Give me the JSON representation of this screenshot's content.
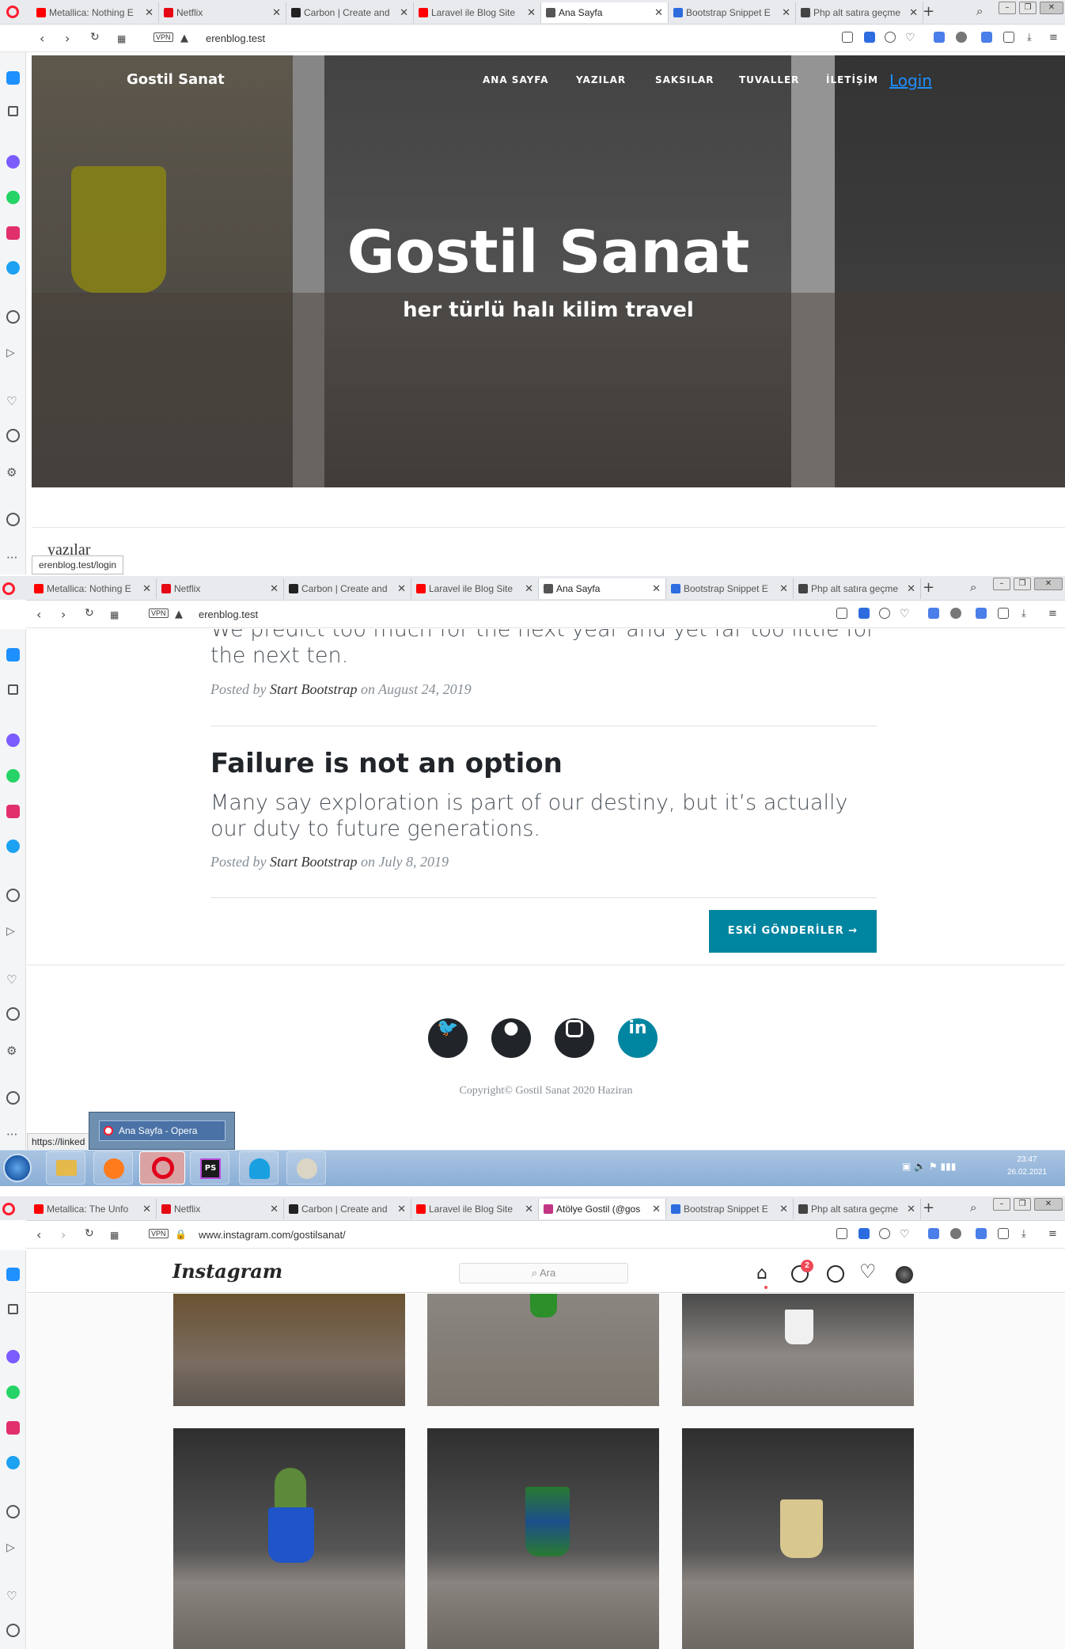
{
  "window1": {
    "tabs": [
      {
        "title": "Metallica: Nothing E",
        "color": "#ff0000"
      },
      {
        "title": "Netflix",
        "color": "#e50914"
      },
      {
        "title": "Carbon | Create and",
        "color": "#222222"
      },
      {
        "title": "Laravel ile Blog Site",
        "color": "#ff0000"
      },
      {
        "title": "Ana Sayfa",
        "color": "#555555",
        "active": true
      },
      {
        "title": "Bootstrap Snippet E",
        "color": "#2d6cdf"
      },
      {
        "title": "Php alt satıra geçme",
        "color": "#444444"
      }
    ],
    "url": "erenblog.test",
    "site": {
      "brand": "Gostil Sanat",
      "nav": [
        "ANA SAYFA",
        "YAZILAR",
        "SAKSILAR",
        "TUVALLER",
        "İLETİŞİM"
      ],
      "login": "Login",
      "hero_title": "Gostil Sanat",
      "hero_subtitle": "her türlü halı kilim travel",
      "section_label": "yazılar"
    },
    "status_tooltip": "erenblog.test/login"
  },
  "window2": {
    "tabs": [
      {
        "title": "Metallica: Nothing E",
        "color": "#ff0000"
      },
      {
        "title": "Netflix",
        "color": "#e50914"
      },
      {
        "title": "Carbon | Create and",
        "color": "#222222"
      },
      {
        "title": "Laravel ile Blog Site",
        "color": "#ff0000"
      },
      {
        "title": "Ana Sayfa",
        "color": "#555555",
        "active": true
      },
      {
        "title": "Bootstrap Snippet E",
        "color": "#2d6cdf"
      },
      {
        "title": "Php alt satıra geçme",
        "color": "#444444"
      }
    ],
    "url": "erenblog.test",
    "posts": [
      {
        "subtitle": "We predict too much for the next year and yet far too little for the next ten.",
        "posted_by": "Posted by",
        "author": "Start Bootstrap",
        "date": "on August 24, 2019"
      },
      {
        "title": "Failure is not an option",
        "subtitle": "Many say exploration is part of our destiny, but it’s actually our duty to future generations.",
        "posted_by": "Posted by",
        "author": "Start Bootstrap",
        "date": "on July 8, 2019"
      }
    ],
    "older_button": "ESKİ GÖNDERİLER →",
    "social": [
      "twitter",
      "github",
      "instagram",
      "linkedin"
    ],
    "copyright": "Copyright© Gostil Sanat 2020 Haziran",
    "status_link": "https://linked",
    "taskbar_preview": "Ana Sayfa - Opera"
  },
  "taskbar": {
    "time": "23:47",
    "date": "26.02.2021"
  },
  "window3": {
    "tabs": [
      {
        "title": "Metallica: The Unfo",
        "color": "#ff0000"
      },
      {
        "title": "Netflix",
        "color": "#e50914"
      },
      {
        "title": "Carbon | Create and",
        "color": "#222222"
      },
      {
        "title": "Laravel ile Blog Site",
        "color": "#ff0000"
      },
      {
        "title": "Atölye Gostil (@gos",
        "color": "#c13584",
        "active": true
      },
      {
        "title": "Bootstrap Snippet E",
        "color": "#2d6cdf"
      },
      {
        "title": "Php alt satıra geçme",
        "color": "#444444"
      }
    ],
    "url": "www.instagram.com/gostilsanat/",
    "instagram": {
      "logo": "Instagram",
      "search_placeholder": "Ara",
      "notification_count": "2"
    }
  },
  "colors": {
    "accent": "#0085a1",
    "dark": "#212529",
    "opera_red": "#ff1b2d"
  }
}
